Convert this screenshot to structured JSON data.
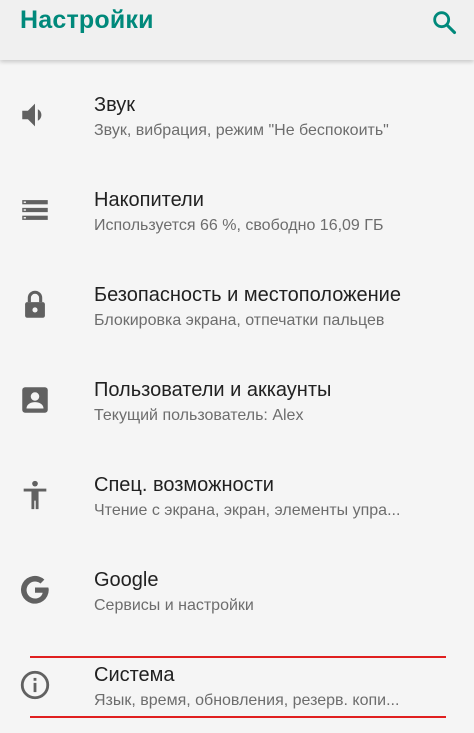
{
  "header": {
    "title": "Настройки",
    "search_icon": "search-icon"
  },
  "items": [
    {
      "icon": "volume-icon",
      "title": "Звук",
      "summary": "Звук, вибрация, режим \"Не беспокоить\""
    },
    {
      "icon": "storage-icon",
      "title": "Накопители",
      "summary": "Используется 66 %, свободно 16,09 ГБ"
    },
    {
      "icon": "lock-icon",
      "title": "Безопасность и местоположение",
      "summary": "Блокировка экрана, отпечатки пальцев"
    },
    {
      "icon": "account-box-icon",
      "title": "Пользователи и аккаунты",
      "summary": "Текущий пользователь: Alex"
    },
    {
      "icon": "accessibility-icon",
      "title": "Спец. возможности",
      "summary": "Чтение с экрана, экран, элементы упра..."
    },
    {
      "icon": "google-icon",
      "title": "Google",
      "summary": "Сервисы и настройки"
    },
    {
      "icon": "info-icon",
      "title": "Система",
      "summary": "Язык, время, обновления, резерв. копи..."
    }
  ],
  "colors": {
    "accent": "#00897b",
    "icon": "#616161",
    "highlight": "#e02020"
  }
}
